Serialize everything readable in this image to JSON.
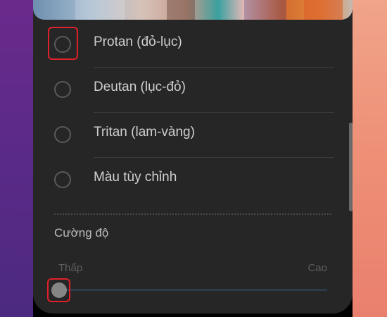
{
  "colors": {
    "accent_highlight": "#e0202a",
    "background": "#262626",
    "text_primary": "#cfcfcf",
    "text_muted": "#5e5e5e"
  },
  "options": [
    {
      "label": "Protan (đỏ-lục)",
      "icon": "radio-unchecked-icon",
      "highlighted": true
    },
    {
      "label": "Deutan (lục-đỏ)",
      "icon": "radio-unchecked-icon",
      "highlighted": false
    },
    {
      "label": "Tritan (lam-vàng)",
      "icon": "radio-unchecked-icon",
      "highlighted": false
    },
    {
      "label": "Màu tùy chỉnh",
      "icon": "radio-unchecked-icon",
      "highlighted": false
    }
  ],
  "intensity": {
    "title": "Cường độ",
    "min_label": "Thấp",
    "max_label": "Cao",
    "value": 0,
    "thumb_highlighted": true
  }
}
